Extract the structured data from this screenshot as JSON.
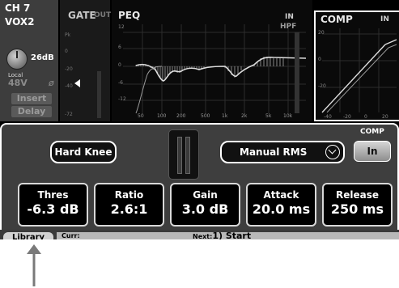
{
  "channel": {
    "number": "CH 7",
    "name": "VOX2",
    "gain": "26dB",
    "source": "Local",
    "phantom": "48V",
    "phase": "ø",
    "insert_label": "Insert",
    "delay_label": "Delay"
  },
  "gate": {
    "title": "GATE",
    "status": "OUT",
    "ticks": [
      "Pk",
      "0",
      "-20",
      "-40",
      "-72"
    ]
  },
  "peq": {
    "title": "PEQ",
    "status": "IN",
    "hpf_label": "HPF",
    "y_ticks": [
      "12",
      "6",
      "0",
      "-6",
      "-12"
    ],
    "freq_ticks": [
      "50",
      "100",
      "200",
      "500",
      "1k",
      "2k",
      "5k",
      "10k"
    ]
  },
  "comp": {
    "title": "COMP",
    "status": "IN",
    "y_ticks": [
      "20",
      "0",
      "-20"
    ],
    "x_ticks": [
      "-40",
      "-20",
      "0",
      "20"
    ],
    "panel_label": "COMP",
    "button_label": "In",
    "knee_label": "Hard Knee",
    "detect_label": "Manual RMS",
    "params": [
      {
        "name": "Thres",
        "value": "-6.3 dB"
      },
      {
        "name": "Ratio",
        "value": "2.6:1"
      },
      {
        "name": "Gain",
        "value": "3.0 dB"
      },
      {
        "name": "Attack",
        "value": "20.0 ms"
      },
      {
        "name": "Release",
        "value": "250 ms"
      }
    ]
  },
  "statusbar": {
    "library_label": "Library",
    "curr_label": "Curr:",
    "next_label": "Next:",
    "next_value": "1) Start"
  },
  "colors": {
    "accent_border": "#ffffff",
    "panel_bg": "#3e3e3e",
    "curve": "#dddddd"
  }
}
